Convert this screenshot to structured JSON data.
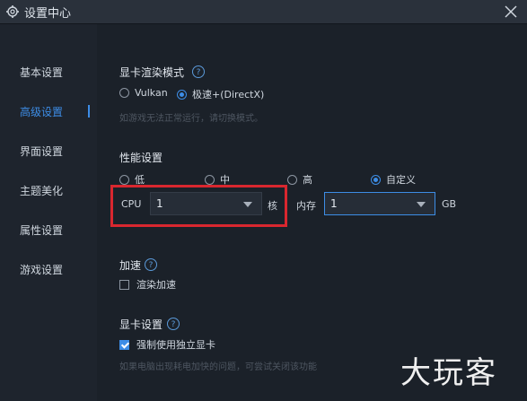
{
  "window": {
    "title": "设置中心"
  },
  "sidebar": {
    "items": [
      {
        "label": "基本设置"
      },
      {
        "label": "高级设置"
      },
      {
        "label": "界面设置"
      },
      {
        "label": "主题美化"
      },
      {
        "label": "属性设置"
      },
      {
        "label": "游戏设置"
      }
    ],
    "active_index": 1
  },
  "render": {
    "title": "显卡渲染模式",
    "options": [
      {
        "label": "Vulkan"
      },
      {
        "label": "极速+(DirectX)"
      }
    ],
    "selected_index": 1,
    "hint": "如游戏无法正常运行，请切换模式。"
  },
  "performance": {
    "title": "性能设置",
    "options": [
      {
        "label": "低"
      },
      {
        "label": "中"
      },
      {
        "label": "高"
      },
      {
        "label": "自定义"
      }
    ],
    "selected_index": 3,
    "cpu_label": "CPU",
    "cpu_value": "1",
    "cpu_unit": "核",
    "mem_label": "内存",
    "mem_value": "1",
    "mem_unit": "GB"
  },
  "accel": {
    "title": "加速",
    "checkbox_label": "渲染加速",
    "checked": false
  },
  "gpu": {
    "title": "显卡设置",
    "checkbox_label": "强制使用独立显卡",
    "checked": true,
    "hint": "如果电脑出现耗电加快的问题，可尝试关闭该功能"
  },
  "watermark": {
    "text": "大玩客"
  },
  "colors": {
    "accent": "#3d8de6",
    "background": "#1b2129",
    "highlight": "#d9272f"
  }
}
